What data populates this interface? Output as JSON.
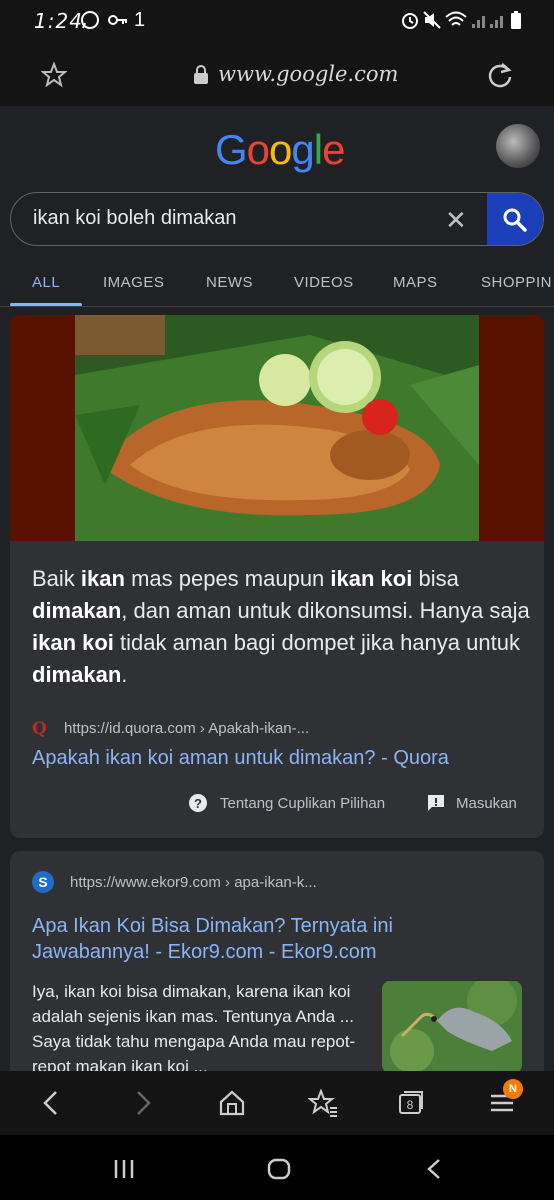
{
  "status_bar": {
    "time": "1:24",
    "extra": "1"
  },
  "browser": {
    "url": "www.google.com"
  },
  "google": {
    "logo": [
      "G",
      "o",
      "o",
      "g",
      "l",
      "e"
    ],
    "logo_colors": [
      "#4285f4",
      "#ea4335",
      "#fbbc05",
      "#4285f4",
      "#34a853",
      "#ea4335"
    ],
    "search_query": "ikan koi boleh dimakan",
    "tabs": [
      "ALL",
      "IMAGES",
      "NEWS",
      "VIDEOS",
      "MAPS",
      "SHOPPIN"
    ]
  },
  "featured": {
    "snippet_parts": [
      "Baik ",
      "ikan",
      " mas pepes maupun ",
      "ikan koi",
      " bisa ",
      "dimakan",
      ", dan aman untuk dikonsumsi. Hanya saja ",
      "ikan koi",
      " tidak aman bagi dompet jika hanya untuk ",
      "dimakan",
      "."
    ],
    "source_url": "https://id.quora.com › Apakah-ikan-...",
    "source_icon": "Q",
    "title": "Apakah ikan koi aman untuk dimakan? - Quora",
    "about_label": "Tentang Cuplikan Pilihan",
    "feedback_label": "Masukan"
  },
  "result2": {
    "source_url": "https://www.ekor9.com › apa-ikan-k...",
    "title_line1": "Apa Ikan Koi Bisa Dimakan? Ternyata ini",
    "title_line2": "Jawabannya! - Ekor9.com - Ekor9.com",
    "description": "Iya, ikan koi bisa dimakan, karena ikan koi adalah sejenis ikan mas. Tentunya Anda ... Saya tidak tahu mengapa Anda mau repot-repot makan ikan koi ..."
  },
  "bottom_nav": {
    "badge": "N"
  },
  "colors": {
    "accent": "#8ab4f8",
    "search_button": "#1a3fb8",
    "card_bg": "#303134",
    "image_bg": "#5a1200"
  }
}
